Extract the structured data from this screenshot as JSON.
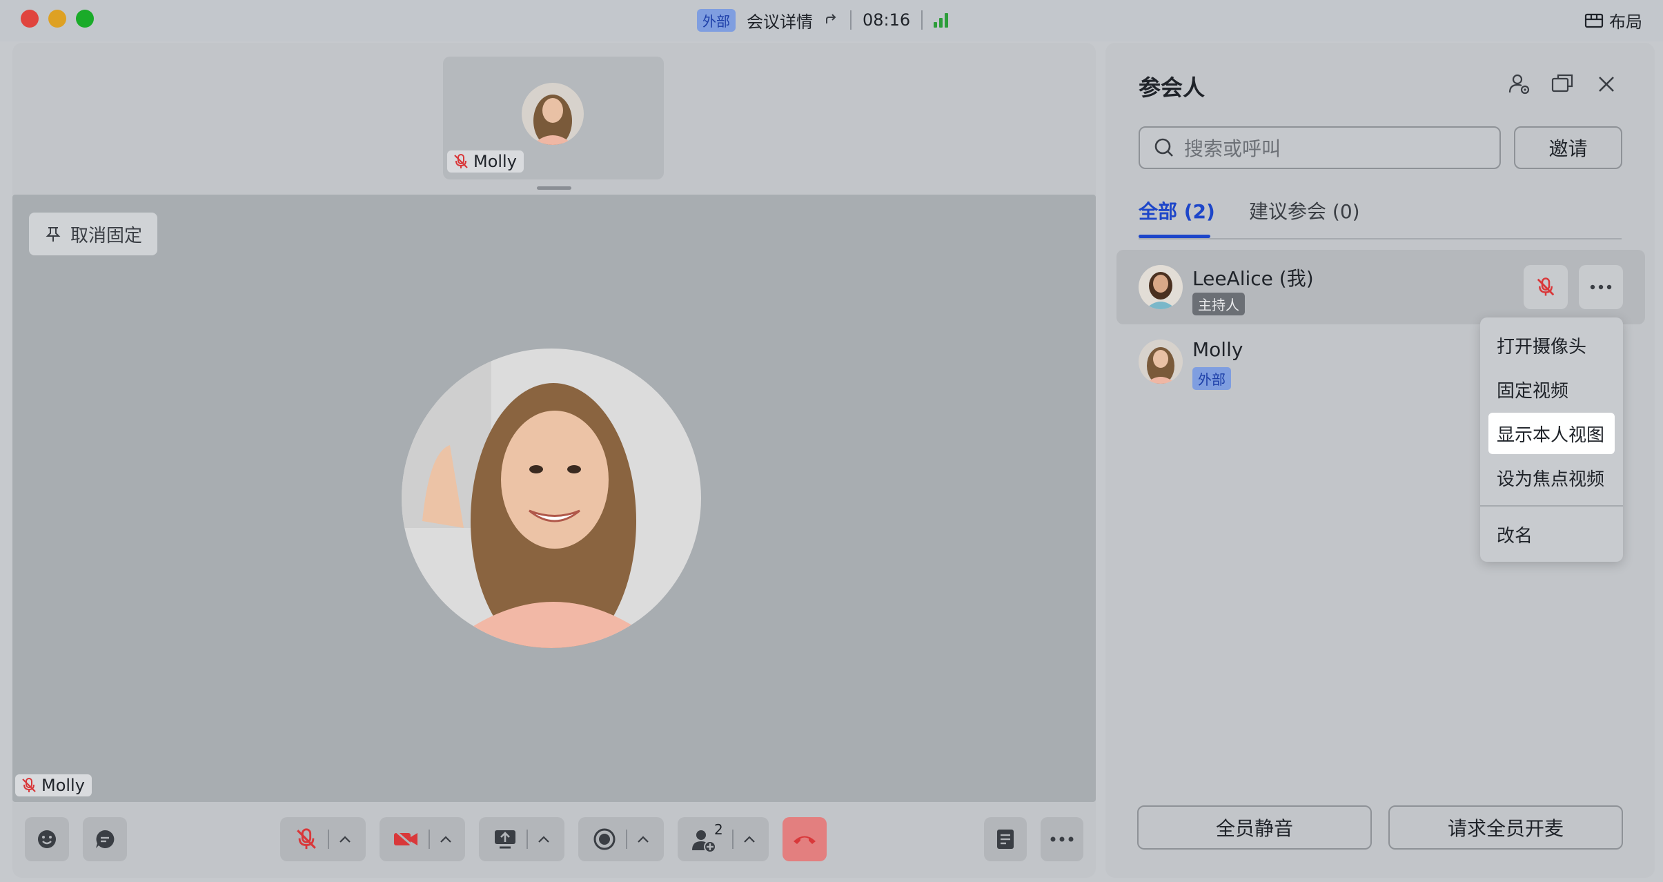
{
  "titlebar": {
    "external_badge": "外部",
    "meeting_details": "会议详情",
    "timer": "08:16",
    "layout_label": "布局"
  },
  "meeting": {
    "thumbnail_name": "Molly",
    "main_name": "Molly",
    "unpin_label": "取消固定"
  },
  "toolbar": {
    "participants_count": "2"
  },
  "participants_panel": {
    "title": "参会人",
    "search_placeholder": "搜索或呼叫",
    "invite_label": "邀请",
    "tabs": [
      {
        "label": "全部 (2)",
        "active": true
      },
      {
        "label": "建议参会 (0)",
        "active": false
      }
    ],
    "participants": [
      {
        "name": "LeeAlice (我)",
        "role": "主持人"
      },
      {
        "name": "Molly",
        "role": "外部"
      }
    ],
    "mute_all_label": "全员静音",
    "request_unmute_label": "请求全员开麦"
  },
  "context_menu": {
    "items": [
      {
        "label": "打开摄像头",
        "highlighted": false
      },
      {
        "label": "固定视频",
        "highlighted": false
      },
      {
        "label": "显示本人视图",
        "highlighted": true
      },
      {
        "label": "设为焦点视频",
        "highlighted": false
      },
      {
        "label": "改名",
        "highlighted": false
      }
    ]
  },
  "colors": {
    "accent": "#1d46c9",
    "danger": "#d9383a",
    "signal": "#2d9d3a"
  }
}
